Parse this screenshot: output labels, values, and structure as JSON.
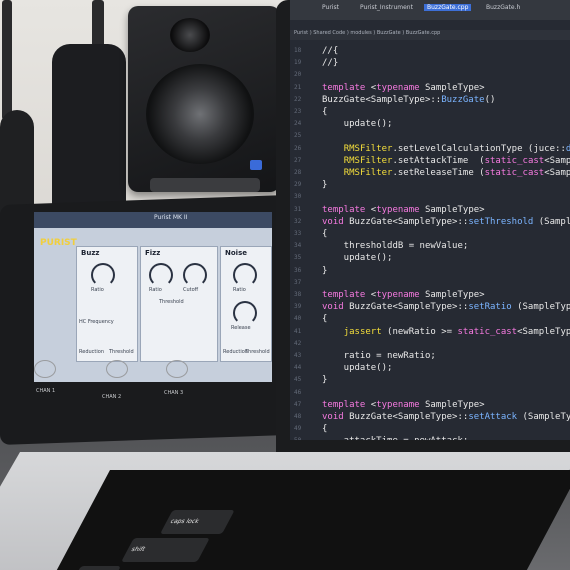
{
  "tablet": {
    "app_logo": "PURIST",
    "app_title": "Purist MK II",
    "panels": [
      {
        "name": "Buzz",
        "labels": [
          "Ratio",
          "HC Frequency",
          "Reduction",
          "Threshold"
        ]
      },
      {
        "name": "Fizz",
        "labels": [
          "Ratio",
          "Cutoff",
          "Threshold"
        ]
      },
      {
        "name": "Noise",
        "labels": [
          "Ratio",
          "Release",
          "Reduction",
          "Threshold"
        ]
      }
    ],
    "channels": [
      "CHAN 1",
      "CHAN 2",
      "CHAN 3"
    ]
  },
  "editor": {
    "tabs": [
      "Purist",
      "Purist_Instrument",
      "BuzzGate.cpp",
      "BuzzGate.h"
    ],
    "breadcrumb": "Purist ) Shared Code ) modules ) BuzzGate ) BuzzGate.cpp",
    "line_numbers": [
      "18",
      "19",
      "20",
      "21",
      "22",
      "23",
      "24",
      "25",
      "26",
      "27",
      "28",
      "29",
      "30",
      "31",
      "32",
      "33",
      "34",
      "35",
      "36",
      "37",
      "38",
      "39",
      "40",
      "41",
      "42",
      "43",
      "44",
      "45",
      "46",
      "47",
      "48",
      "49",
      "50",
      "51",
      "52",
      "53",
      "54",
      "55",
      "56",
      "57"
    ],
    "lines": [
      "//{",
      "//}",
      "",
      "template <typename SampleType>",
      "BuzzGate<SampleType>::BuzzGate()",
      "{",
      "    update();",
      "",
      "    RMSFilter.setLevelCalculationType (juce::dsp",
      "    RMSFilter.setAttackTime  (static_cast<Sample",
      "    RMSFilter.setReleaseTime (static_cast<Sample",
      "}",
      "",
      "template <typename SampleType>",
      "void BuzzGate<SampleType>::setThreshold (SampleTy",
      "{",
      "    thresholddB = newValue;",
      "    update();",
      "}",
      "",
      "template <typename SampleType>",
      "void BuzzGate<SampleType>::setRatio (SampleType",
      "{",
      "    jassert (newRatio >= static_cast<SampleType",
      "",
      "    ratio = newRatio;",
      "    update();",
      "}",
      "",
      "template <typename SampleType>",
      "void BuzzGate<SampleType>::setAttack (SampleType",
      "{",
      "    attackTime = newAttack;"
    ]
  },
  "keyboard": {
    "keys": [
      "caps lock",
      "shift",
      "fn"
    ]
  }
}
